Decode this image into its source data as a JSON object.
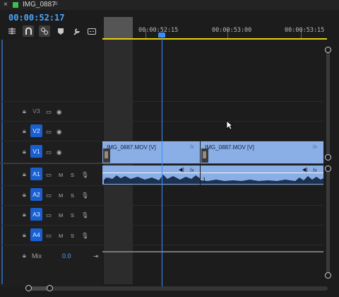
{
  "sequence_tab": {
    "title": "IMG_0887",
    "close": "×",
    "menu": "≡",
    "swatch_color": "#3fbf4f"
  },
  "timecode": "00:00:52:17",
  "toolbar": {
    "icons": [
      "insert-overwrite-icon",
      "snap-magnet-icon",
      "linked-selection-icon",
      "add-marker-icon",
      "wrench-settings-icon",
      "captions-icon"
    ]
  },
  "ruler": {
    "labels": [
      "00:00:52:15",
      "00:00:53:00",
      "00:00:53:15"
    ]
  },
  "tracks": {
    "video": [
      {
        "name": "V3",
        "targeted": false
      },
      {
        "name": "V2",
        "targeted": true
      },
      {
        "name": "V1",
        "targeted": true
      }
    ],
    "audio": [
      {
        "name": "A1",
        "targeted": true,
        "m": "M",
        "s": "S"
      },
      {
        "name": "A2",
        "targeted": true,
        "m": "M",
        "s": "S"
      },
      {
        "name": "A3",
        "targeted": true,
        "m": "M",
        "s": "S"
      },
      {
        "name": "A4",
        "targeted": true,
        "m": "M",
        "s": "S"
      }
    ],
    "mix": {
      "label": "Mix",
      "value": "0.0"
    }
  },
  "clips": {
    "video": [
      {
        "name": "IMG_0887.MOV [V]",
        "fx": "fx"
      },
      {
        "name": "IMG_0887.MOV [V]",
        "fx": "fx"
      }
    ],
    "audio": [
      {
        "num": "1",
        "fx": "fx"
      },
      {
        "num": "1",
        "fx": "fx"
      }
    ]
  },
  "colors": {
    "accent": "#4aa8ff",
    "clip": "#8aaee6",
    "track_target": "#1a5fd0",
    "work_area": "#e5d210"
  }
}
